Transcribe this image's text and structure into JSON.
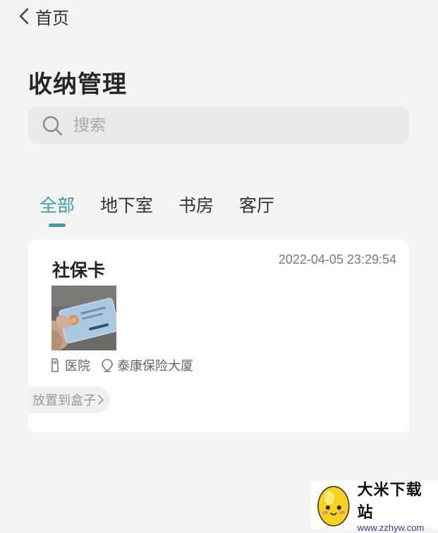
{
  "nav": {
    "back_label": "首页",
    "back_icon": "chevron-left-icon"
  },
  "page": {
    "title": "收纳管理"
  },
  "search": {
    "placeholder": "搜索",
    "value": "",
    "icon": "search-icon"
  },
  "tabs": [
    {
      "label": "全部",
      "active": true
    },
    {
      "label": "地下室",
      "active": false
    },
    {
      "label": "书房",
      "active": false
    },
    {
      "label": "客厅",
      "active": false
    }
  ],
  "items": [
    {
      "name": "社保卡",
      "timestamp": "2022-04-05 23:29:54",
      "photo": "social-security-card-photo",
      "room": "医院",
      "room_icon": "tag-icon",
      "location": "泰康保险大厦",
      "location_icon": "location-pin-icon",
      "action_label": "放置到盒子"
    }
  ],
  "watermark": {
    "title": "大米下载站",
    "url": "www.zzhyw.com"
  },
  "colors": {
    "accent": "#3e9e9e",
    "background": "#f4f4f4",
    "card": "#ffffff",
    "search_bg": "#e9e9e9",
    "muted_text": "#7a7a7a"
  }
}
